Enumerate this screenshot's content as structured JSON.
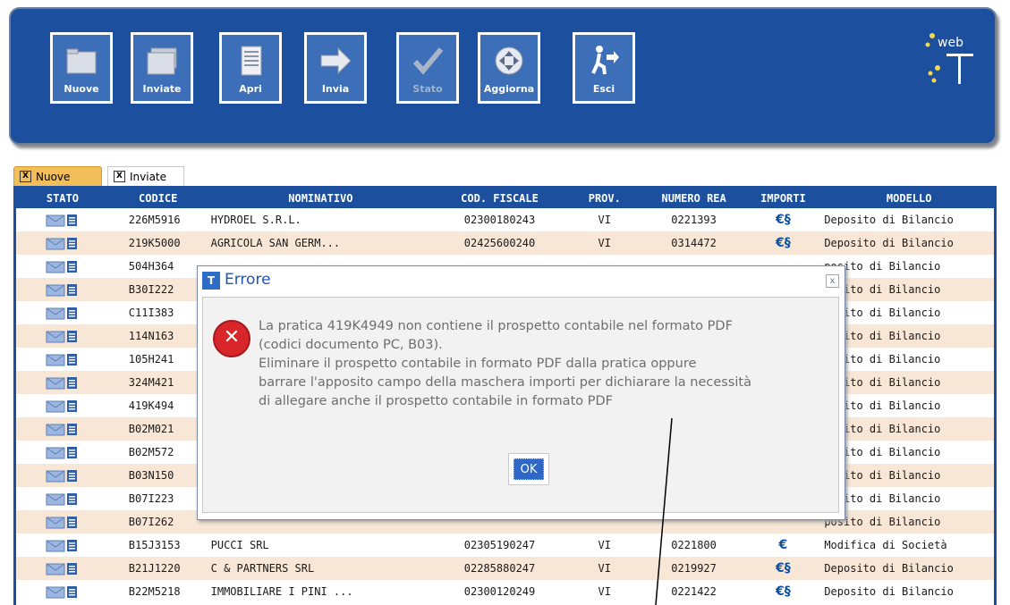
{
  "toolbar": {
    "buttons": [
      {
        "label": "Nuove",
        "icon": "folder-icon"
      },
      {
        "label": "Inviate",
        "icon": "folders-icon"
      },
      {
        "label": "Apri",
        "icon": "document-icon"
      },
      {
        "label": "Invia",
        "icon": "arrow-right-icon"
      },
      {
        "label": "Stato",
        "icon": "checkmark-icon"
      },
      {
        "label": "Aggiorna",
        "icon": "refresh-icon"
      },
      {
        "label": "Esci",
        "icon": "exit-icon"
      }
    ],
    "logo_text": "web"
  },
  "tabs": [
    {
      "label": "Nuove",
      "close": "X"
    },
    {
      "label": "Inviate",
      "close": "X"
    }
  ],
  "table": {
    "headers": [
      "STATO",
      "CODICE",
      "NOMINATIVO",
      "COD. FISCALE",
      "PROV.",
      "NUMERO REA",
      "IMPORTI",
      "MODELLO"
    ],
    "rows": [
      {
        "codice": "226M5916",
        "nome": "HYDROEL S.R.L.",
        "cf": "02300180243",
        "prov": "VI",
        "rea": "0221393",
        "importi": "euro-doc",
        "modello": "Deposito di Bilancio"
      },
      {
        "codice": "219K5000",
        "nome": "AGRICOLA SAN GERM...",
        "cf": "02425600240",
        "prov": "VI",
        "rea": "0314472",
        "importi": "euro-doc",
        "modello": "Deposito di Bilancio"
      },
      {
        "codice": "504H364",
        "nome": "",
        "cf": "",
        "prov": "",
        "rea": "",
        "importi": "",
        "modello": "posito di Bilancio"
      },
      {
        "codice": "B30I222",
        "nome": "",
        "cf": "",
        "prov": "",
        "rea": "",
        "importi": "",
        "modello": "posito di Bilancio"
      },
      {
        "codice": "C11I383",
        "nome": "",
        "cf": "",
        "prov": "",
        "rea": "",
        "importi": "",
        "modello": "posito di Bilancio"
      },
      {
        "codice": "114N163",
        "nome": "",
        "cf": "",
        "prov": "",
        "rea": "",
        "importi": "",
        "modello": "posito di Bilancio"
      },
      {
        "codice": "105H241",
        "nome": "",
        "cf": "",
        "prov": "",
        "rea": "",
        "importi": "",
        "modello": "posito di Bilancio"
      },
      {
        "codice": "324M421",
        "nome": "",
        "cf": "",
        "prov": "",
        "rea": "",
        "importi": "",
        "modello": "posito di Bilancio"
      },
      {
        "codice": "419K494",
        "nome": "",
        "cf": "",
        "prov": "",
        "rea": "",
        "importi": "",
        "modello": "posito di Bilancio"
      },
      {
        "codice": "B02M021",
        "nome": "",
        "cf": "",
        "prov": "",
        "rea": "",
        "importi": "",
        "modello": "posito di Bilancio"
      },
      {
        "codice": "B02M572",
        "nome": "",
        "cf": "",
        "prov": "",
        "rea": "",
        "importi": "",
        "modello": "posito di Bilancio"
      },
      {
        "codice": "B03N150",
        "nome": "",
        "cf": "",
        "prov": "",
        "rea": "",
        "importi": "",
        "modello": "posito di Bilancio"
      },
      {
        "codice": "B07I223",
        "nome": "",
        "cf": "",
        "prov": "",
        "rea": "",
        "importi": "",
        "modello": "posito di Bilancio"
      },
      {
        "codice": "B07I262",
        "nome": "",
        "cf": "",
        "prov": "",
        "rea": "",
        "importi": "",
        "modello": "posito di Bilancio"
      },
      {
        "codice": "B15J3153",
        "nome": "PUCCI SRL",
        "cf": "02305190247",
        "prov": "VI",
        "rea": "0221800",
        "importi": "euro",
        "modello": "Modifica di Società"
      },
      {
        "codice": "B21J1220",
        "nome": "C & PARTNERS SRL",
        "cf": "02285880247",
        "prov": "VI",
        "rea": "0219927",
        "importi": "euro-doc",
        "modello": "Deposito di Bilancio"
      },
      {
        "codice": "B22M5218",
        "nome": "IMMOBILIARE I PINI ...",
        "cf": "02300120249",
        "prov": "VI",
        "rea": "0221422",
        "importi": "euro-doc",
        "modello": "Deposito di Bilancio"
      }
    ]
  },
  "dialog": {
    "title": "Errore",
    "title_icon": "T",
    "close": "x",
    "message_lines": [
      "La pratica 419K4949 non contiene il prospetto contabile nel formato PDF",
      "(codici documento PC, B03).",
      "Eliminare il prospetto contabile in formato PDF dalla pratica oppure",
      "barrare l'apposito campo della maschera importi per dichiarare la necessità",
      "di allegare anche il prospetto contabile in formato PDF"
    ],
    "ok_label": "OK"
  },
  "colors": {
    "toolbar_bg": "#1d4f9f",
    "header_bg": "#1d4f9f",
    "row_alt": "#f8e7d6",
    "tab_active": "#f2be5a",
    "dialog_title": "#1e54b3",
    "error_red": "#d8262a"
  }
}
